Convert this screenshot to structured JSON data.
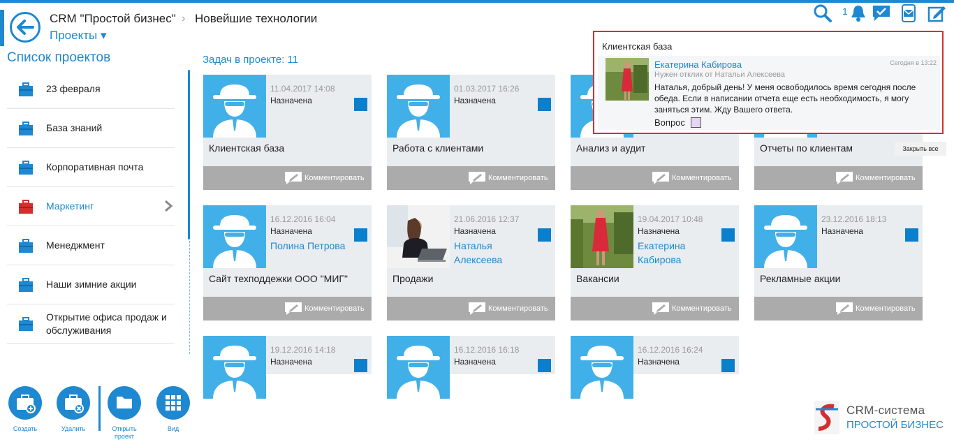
{
  "header": {
    "crumb_root": "CRM \"Простой бизнес\"",
    "crumb_current": "Новейшие технологии",
    "projects_menu": "Проекты ▾",
    "notifications_count": "1"
  },
  "sidebar": {
    "title": "Список проектов",
    "items": [
      {
        "label": "23 февраля",
        "color": "#1e88d0"
      },
      {
        "label": "База знаний",
        "color": "#1e88d0"
      },
      {
        "label": "Корпоративная почта",
        "color": "#1e88d0"
      },
      {
        "label": "Маркетинг",
        "color": "#d32f2f"
      },
      {
        "label": "Менеджмент",
        "color": "#1e88d0"
      },
      {
        "label": "Наши зимние акции",
        "color": "#1e88d0"
      },
      {
        "label": "Открытие офиса продаж и обслуживания",
        "color": "#1e88d0"
      }
    ]
  },
  "main": {
    "task_count": "Задач в проекте: 11",
    "comment_label": "Комментировать",
    "cards": [
      {
        "date": "11.04.2017 14:08",
        "status": "Назначена",
        "person": "",
        "title": "Клиентская база",
        "avatar": "agent-icon"
      },
      {
        "date": "01.03.2017 16:26",
        "status": "Назначена",
        "person": "",
        "title": "Работа с клиентами",
        "avatar": "agent-icon"
      },
      {
        "date": "",
        "status": "",
        "person": "",
        "title": "Анализ и аудит",
        "avatar": "agent-icon"
      },
      {
        "date": "",
        "status": "",
        "person": "",
        "title": "Отчеты по клиентам",
        "avatar": "agent-icon"
      },
      {
        "date": "16.12.2016 16:04",
        "status": "Назначена",
        "person": "Полина Петрова",
        "title": "Сайт техподдежки ООО \"МИГ\"",
        "avatar": "agent-icon"
      },
      {
        "date": "21.06.2016 12:37",
        "status": "Назначена",
        "person": "Наталья Алексеева",
        "title": "Продажи",
        "avatar": "woman-laptop-photo"
      },
      {
        "date": "19.04.2017 10:48",
        "status": "Назначена",
        "person": "Екатерина Кабирова",
        "title": "Вакансии",
        "avatar": "woman-red-dress-photo"
      },
      {
        "date": "23.12.2016 18:13",
        "status": "Назначена",
        "person": "",
        "title": "Рекламные акции",
        "avatar": "agent-icon"
      },
      {
        "date": "19.12.2016 14:18",
        "status": "Назначена",
        "person": "",
        "title": "",
        "avatar": "agent-icon"
      },
      {
        "date": "16.12.2016 16:18",
        "status": "Назначена",
        "person": "",
        "title": "",
        "avatar": "agent-icon"
      },
      {
        "date": "16.12.2016 16:24",
        "status": "Назначена",
        "person": "",
        "title": "",
        "avatar": "agent-icon"
      }
    ]
  },
  "popup": {
    "header": "Клиентская база",
    "name": "Екатерина Кабирова",
    "time": "Сегодня в 13:22",
    "subtitle": "Нужен отклик от Натальи Алексеева",
    "text": "Наталья, добрый день! У меня освободилось время сегодня после обеда. Если в написании отчета еще есть необходимость, я могу заняться этим. Жду Вашего ответа.",
    "type": "Вопрос",
    "close_all": "Закрыть все"
  },
  "bottom": {
    "create": "Создать",
    "delete": "Удалить",
    "open_line1": "Открыть",
    "open_line2": "проект",
    "view": "Вид"
  },
  "logo": {
    "line1": "CRM-система",
    "line2": "ПРОСТОЙ БИЗНЕС"
  },
  "colors": {
    "accent": "#1e88d0",
    "card_bg": "#e9edf0",
    "comment_bar": "#ababab",
    "status_square": "#0a7fcc",
    "popup_border": "#d62f2f",
    "question_swatch": "#e5d5f5"
  }
}
